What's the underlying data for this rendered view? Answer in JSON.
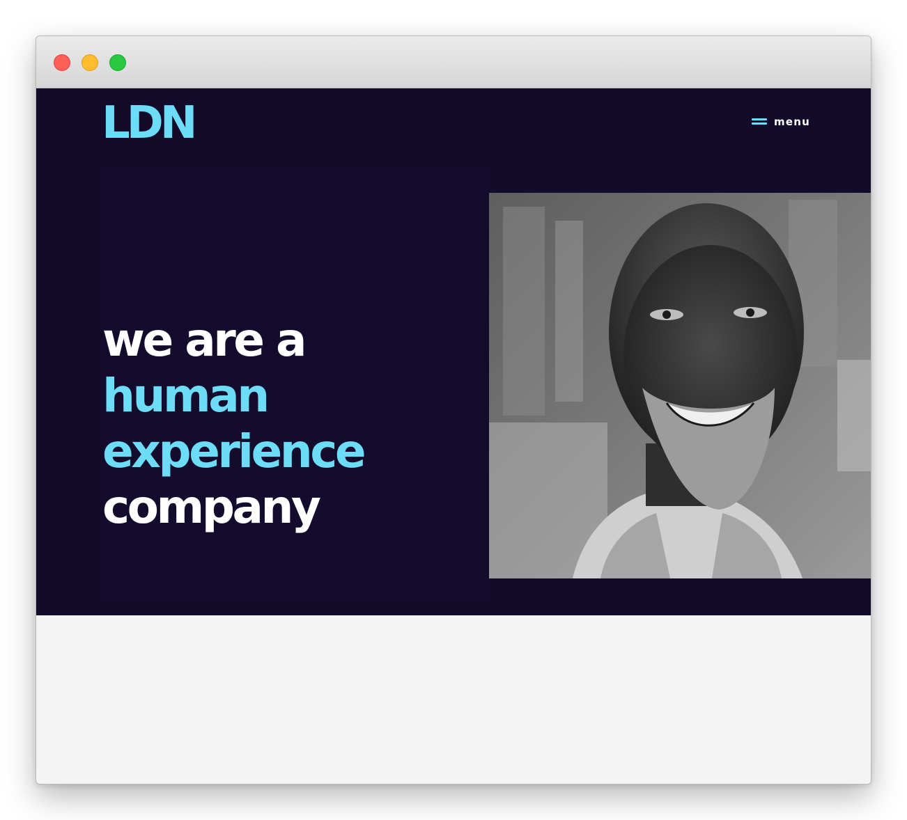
{
  "brand": {
    "logo_text": "LDN",
    "accent_color": "#6ddcf6",
    "background_color": "#130b2a"
  },
  "nav": {
    "menu_label": "menu",
    "menu_icon": "hamburger-icon"
  },
  "hero": {
    "headline_lines": [
      {
        "text": "we are a",
        "color": "#ffffff"
      },
      {
        "text": "human",
        "color": "#6ddcf6"
      },
      {
        "text": "experience",
        "color": "#6ddcf6"
      },
      {
        "text": "company",
        "color": "#ffffff"
      }
    ],
    "image_subject": "smiling man portrait"
  }
}
